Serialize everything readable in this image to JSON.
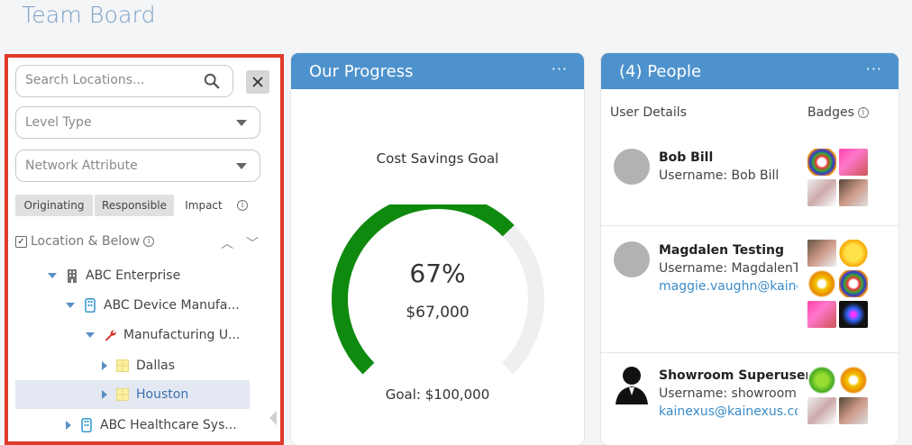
{
  "page": {
    "title": "Team Board"
  },
  "locations": {
    "search_placeholder": "Search Locations...",
    "level_type": "Level Type",
    "network_attribute": "Network Attribute",
    "segments": [
      "Originating",
      "Responsible",
      "Impact"
    ],
    "location_below": "Location & Below",
    "tree": [
      {
        "label": "ABC Enterprise",
        "icon": "building-icon",
        "expanded": true
      },
      {
        "label": "ABC Device Manufa...",
        "icon": "org-icon",
        "expanded": true
      },
      {
        "label": "Manufacturing U...",
        "icon": "wrench-icon",
        "expanded": true
      },
      {
        "label": "Dallas",
        "icon": "grid-icon",
        "expanded": false
      },
      {
        "label": "Houston",
        "icon": "grid-icon",
        "expanded": false,
        "selected": true
      },
      {
        "label": "ABC Healthcare Sys...",
        "icon": "org-icon",
        "expanded": false
      }
    ]
  },
  "progress": {
    "header": "Our Progress",
    "menu": "···",
    "goal_title": "Cost Savings Goal",
    "percent_label": "67%",
    "percent_value": 0.67,
    "amount": "$67,000",
    "goal": "Goal: $100,000",
    "colors": {
      "fill": "#0f8a0f",
      "track": "#efefef"
    }
  },
  "people": {
    "header": "(4) People",
    "menu": "···",
    "col_user": "User Details",
    "col_badges": "Badges",
    "rows": [
      {
        "name": "Bob Bill",
        "username": "Username: Bob Bill",
        "email": ""
      },
      {
        "name": "Magdalen Testing",
        "username": "Username: MagdalenTesting",
        "email": "maggie.vaughn@kainexus.com"
      },
      {
        "name": "Showroom Superuser",
        "username": "Username: showroom",
        "email": "kainexus@kainexus.com"
      }
    ]
  },
  "colors": {
    "accent": "#4d92cc",
    "highlight": "#e03a2a"
  }
}
